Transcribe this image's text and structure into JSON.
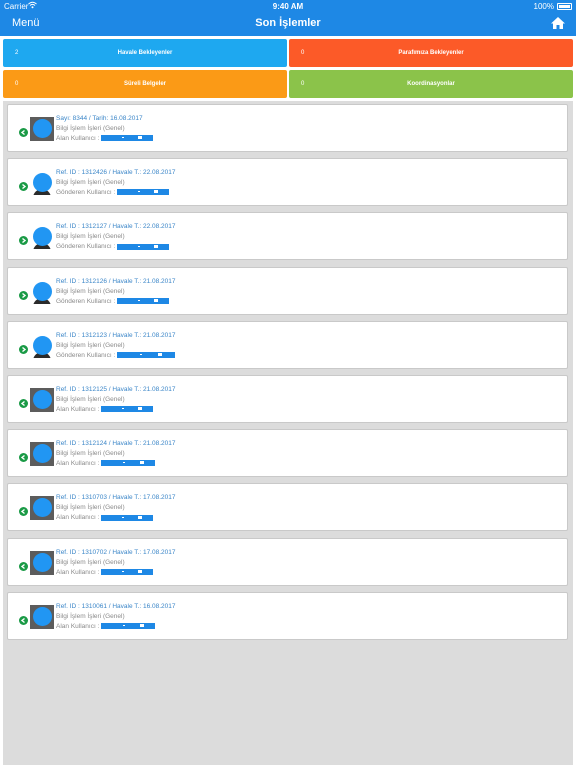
{
  "status_bar": {
    "carrier": "Carrier",
    "time": "9:40 AM",
    "battery": "100%"
  },
  "nav": {
    "menu_label": "Menü",
    "title": "Son İşlemler"
  },
  "dashboard": [
    {
      "count": "2",
      "label": "Havale Bekleyenler",
      "color": "#1ea8f0"
    },
    {
      "count": "0",
      "label": "Parafımıza Bekleyenler",
      "color": "#fc5a28"
    },
    {
      "count": "0",
      "label": "Süreli Belgeler",
      "color": "#fb9a16"
    },
    {
      "count": "0",
      "label": "Koordinasyonlar",
      "color": "#8bc34a"
    }
  ],
  "accent_colors": {
    "primary": "#1e88e5",
    "incoming": "#1a9a46",
    "outgoing": "#1a9a46"
  },
  "items": [
    {
      "title": "Sayı: 8344 / Tarih: 16.08.2017",
      "category": "Bilgi İşlem İşleri (Genel)",
      "user_label": "Alan Kullanıcı :",
      "direction": "back",
      "avatar": "photo"
    },
    {
      "title": "Ref. ID : 1312426 / Havale T.: 22.08.2017",
      "category": "Bilgi İşlem İşleri (Genel)",
      "user_label": "Gönderen Kullanıcı :",
      "direction": "forward",
      "avatar": "person"
    },
    {
      "title": "Ref. ID : 1312127 / Havale T.: 22.08.2017",
      "category": "Bilgi İşlem İşleri (Genel)",
      "user_label": "Gönderen Kullanıcı :",
      "direction": "forward",
      "avatar": "person"
    },
    {
      "title": "Ref. ID : 1312126 / Havale T.: 21.08.2017",
      "category": "Bilgi İşlem İşleri (Genel)",
      "user_label": "Gönderen Kullanıcı :",
      "direction": "forward",
      "avatar": "person"
    },
    {
      "title": "Ref. ID : 1312123 / Havale T.: 21.08.2017",
      "category": "Bilgi İşlem İşleri (Genel)",
      "user_label": "Gönderen Kullanıcı :",
      "direction": "forward",
      "avatar": "person"
    },
    {
      "title": "Ref. ID : 1312125 / Havale T.: 21.08.2017",
      "category": "Bilgi İşlem İşleri (Genel)",
      "user_label": "Alan Kullanıcı :",
      "direction": "back",
      "avatar": "photo"
    },
    {
      "title": "Ref. ID : 1312124 / Havale T.: 21.08.2017",
      "category": "Bilgi İşlem İşleri (Genel)",
      "user_label": "Alan Kullanıcı :",
      "direction": "back",
      "avatar": "photo"
    },
    {
      "title": "Ref. ID : 1310703 / Havale T.: 17.08.2017",
      "category": "Bilgi İşlem İşleri (Genel)",
      "user_label": "Alan Kullanıcı :",
      "direction": "back",
      "avatar": "photo"
    },
    {
      "title": "Ref. ID : 1310702 / Havale T.: 17.08.2017",
      "category": "Bilgi İşlem İşleri (Genel)",
      "user_label": "Alan Kullanıcı :",
      "direction": "back",
      "avatar": "photo"
    },
    {
      "title": "Ref. ID : 1310061 / Havale T.: 16.08.2017",
      "category": "Bilgi İşlem İşleri (Genel)",
      "user_label": "Alan Kullanıcı :",
      "direction": "back",
      "avatar": "photo"
    }
  ]
}
